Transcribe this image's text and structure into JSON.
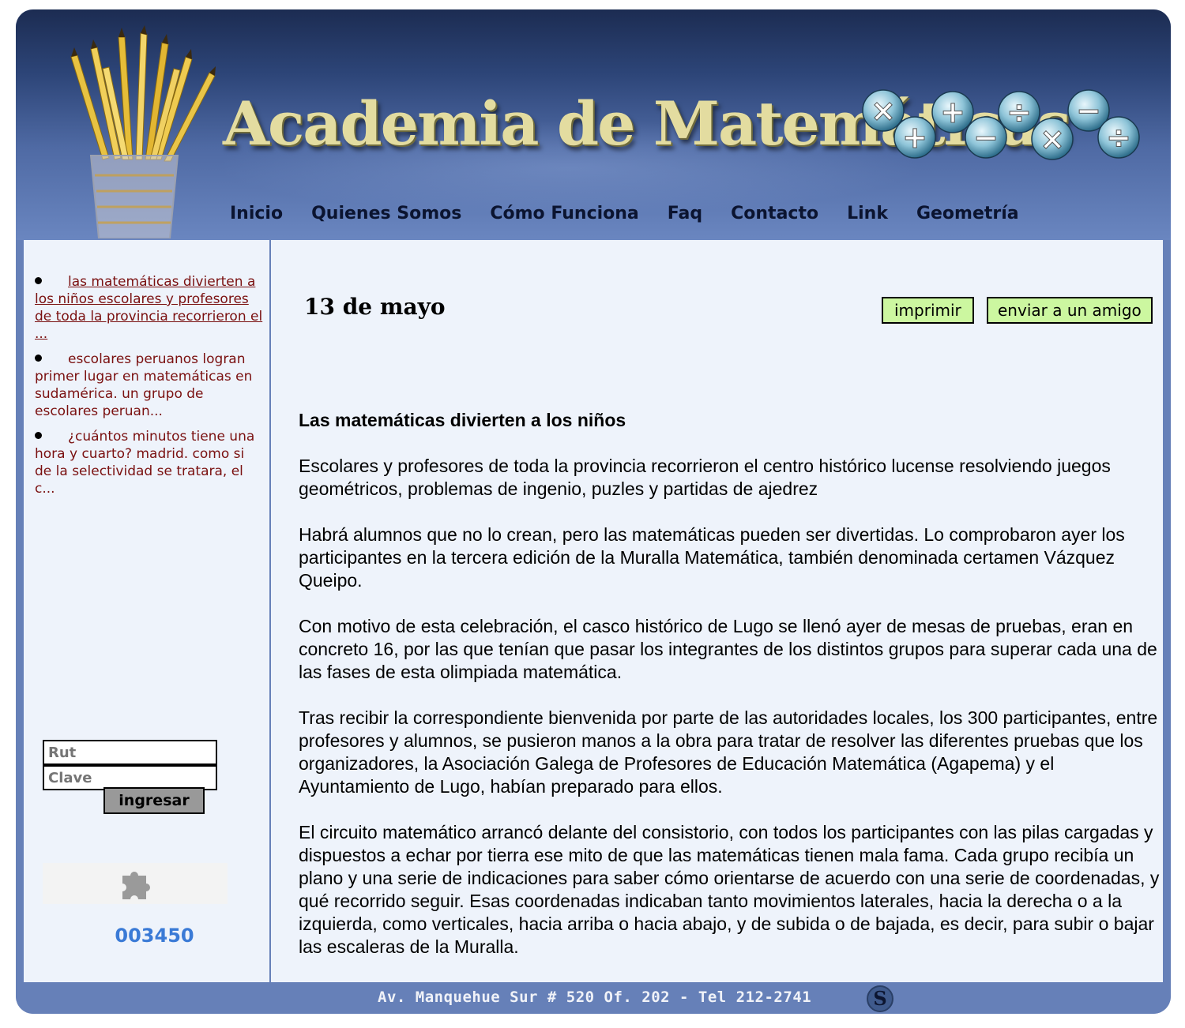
{
  "header": {
    "site_title": "Academia de Matemáticas",
    "icons": [
      "pencil-cup-icon",
      "math-operators-icon"
    ]
  },
  "nav": {
    "items": [
      {
        "label": "Inicio"
      },
      {
        "label": "Quienes Somos"
      },
      {
        "label": "Cómo Funciona"
      },
      {
        "label": "Faq"
      },
      {
        "label": "Contacto"
      },
      {
        "label": "Link"
      },
      {
        "label": "Geometría"
      }
    ]
  },
  "sidebar": {
    "news": [
      {
        "text": "las matemáticas divierten a los niños escolares y profesores de toda la provincia recorrieron el ...",
        "link": true
      },
      {
        "text": "escolares peruanos logran primer lugar en matemáticas en sudamérica. un grupo de escolares peruan...",
        "link": false
      },
      {
        "text": "¿cuántos minutos tiene una hora y cuarto? madrid. como si de la selectividad se tratara, el c...",
        "link": false
      }
    ],
    "login": {
      "rut_placeholder": "Rut",
      "clave_placeholder": "Clave",
      "button_label": "ingresar"
    },
    "plugin_icon": "puzzle-piece-icon",
    "counter": "003450"
  },
  "main": {
    "date": "13 de mayo",
    "print_label": "imprimir",
    "send_label": "enviar a un amigo",
    "article": {
      "title": "Las matemáticas divierten a los niños",
      "paragraphs": [
        "Escolares y profesores de toda la provincia recorrieron el centro histórico lucense resolviendo juegos geométricos, problemas de ingenio, puzles y partidas de ajedrez",
        "Habrá alumnos que no lo crean, pero las matemáticas pueden ser divertidas. Lo comprobaron ayer los participantes en la tercera edición de la Muralla Matemática, también denominada certamen Vázquez Queipo.",
        "Con motivo de esta celebración, el casco histórico de Lugo se llenó ayer de mesas de pruebas, eran en concreto 16, por las que tenían que pasar los integrantes de los distintos grupos para superar cada una de las fases de esta olimpiada matemática.",
        "Tras recibir la correspondiente bienvenida por parte de las autoridades locales, los 300 participantes, entre profesores y alumnos, se pusieron manos a la obra para tratar de resolver las diferentes pruebas que los organizadores, la Asociación Galega de Profesores de Educación Matemática (Agapema) y el Ayuntamiento de Lugo, habían preparado para ellos.",
        "El circuito matemático arrancó delante del consistorio, con todos los participantes con las pilas cargadas y dispuestos a echar por tierra ese mito de que las matemáticas tienen mala fama. Cada grupo recibía un plano y una serie de indicaciones para saber cómo orientarse de acuerdo con una serie de coordenadas, y qué recorrido seguir. Esas coordenadas indicaban tanto movimientos laterales, hacia la derecha o a la izquierda, como verticales, hacia arriba o hacia abajo, y de subida o de bajada, es decir, para subir o bajar las escaleras de la Muralla."
      ]
    }
  },
  "footer": {
    "address": "Av. Manquehue Sur # 520 Of. 202 - Tel 212-2741",
    "icon": "s-logo-icon"
  },
  "colors": {
    "frame": "#6680b8",
    "panel": "#eef3fb",
    "news_text": "#7a1010",
    "action_button": "#ccf7a0",
    "counter": "#3a7ad6",
    "title": "#e3dca0"
  }
}
